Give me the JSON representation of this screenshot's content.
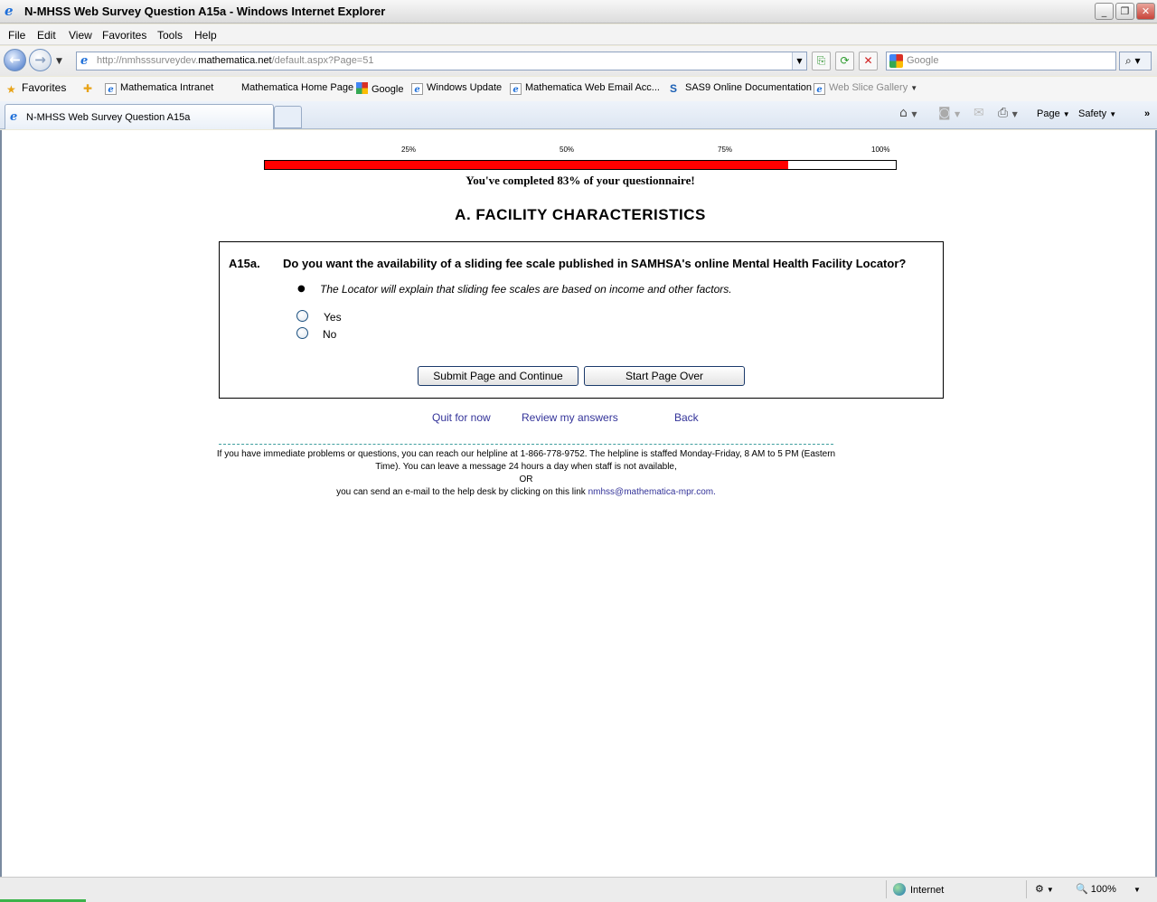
{
  "window": {
    "title": "N-MHSS Web Survey Question A15a - Windows Internet Explorer"
  },
  "menu": [
    "File",
    "Edit",
    "View",
    "Favorites",
    "Tools",
    "Help"
  ],
  "address": {
    "url_prefix": "http://nmhsssurveydev.",
    "url_domain": "mathematica.net",
    "url_suffix": "/default.aspx?Page=51"
  },
  "search": {
    "placeholder": "Google"
  },
  "favorites": {
    "label": "Favorites",
    "items": [
      "Mathematica Intranet",
      "Mathematica Home Page",
      "Google",
      "Windows Update",
      "Mathematica Web Email Acc...",
      "SAS9 Online Documentation",
      "Web Slice Gallery"
    ]
  },
  "tab": {
    "label": "N-MHSS Web Survey Question A15a"
  },
  "commands": {
    "page": "Page",
    "safety": "Safety"
  },
  "progress": {
    "ticks": [
      "25%",
      "50%",
      "75%",
      "100%"
    ],
    "percent": 83,
    "text": "You've completed 83% of your questionnaire!"
  },
  "section": {
    "title": "A. FACILITY CHARACTERISTICS"
  },
  "question": {
    "number": "A15a.",
    "text": "Do you want the availability of a sliding fee scale published in SAMHSA's online Mental Health Facility Locator?",
    "note": "The Locator will explain that sliding fee scales are based on income and other factors.",
    "options": [
      "Yes",
      "No"
    ],
    "submit_label": "Submit Page and Continue",
    "startover_label": "Start Page Over"
  },
  "links": {
    "quit": "Quit for now",
    "review": "Review my answers",
    "back": "Back"
  },
  "help": {
    "line1": "If you have immediate problems or questions, you can reach our helpline at 1-866-778-9752. The helpline is staffed Monday-Friday, 8 AM to 5 PM (Eastern Time). You can leave a message 24 hours a day when staff is not available,",
    "or": "OR",
    "line2": "you can send an e-mail to the help desk by clicking on this link",
    "email": "nmhss@mathematica-mpr.com."
  },
  "status": {
    "zone": "Internet",
    "zoom": "100%"
  },
  "colors": {
    "progress_fill": "#ff0000",
    "link": "#333399"
  }
}
